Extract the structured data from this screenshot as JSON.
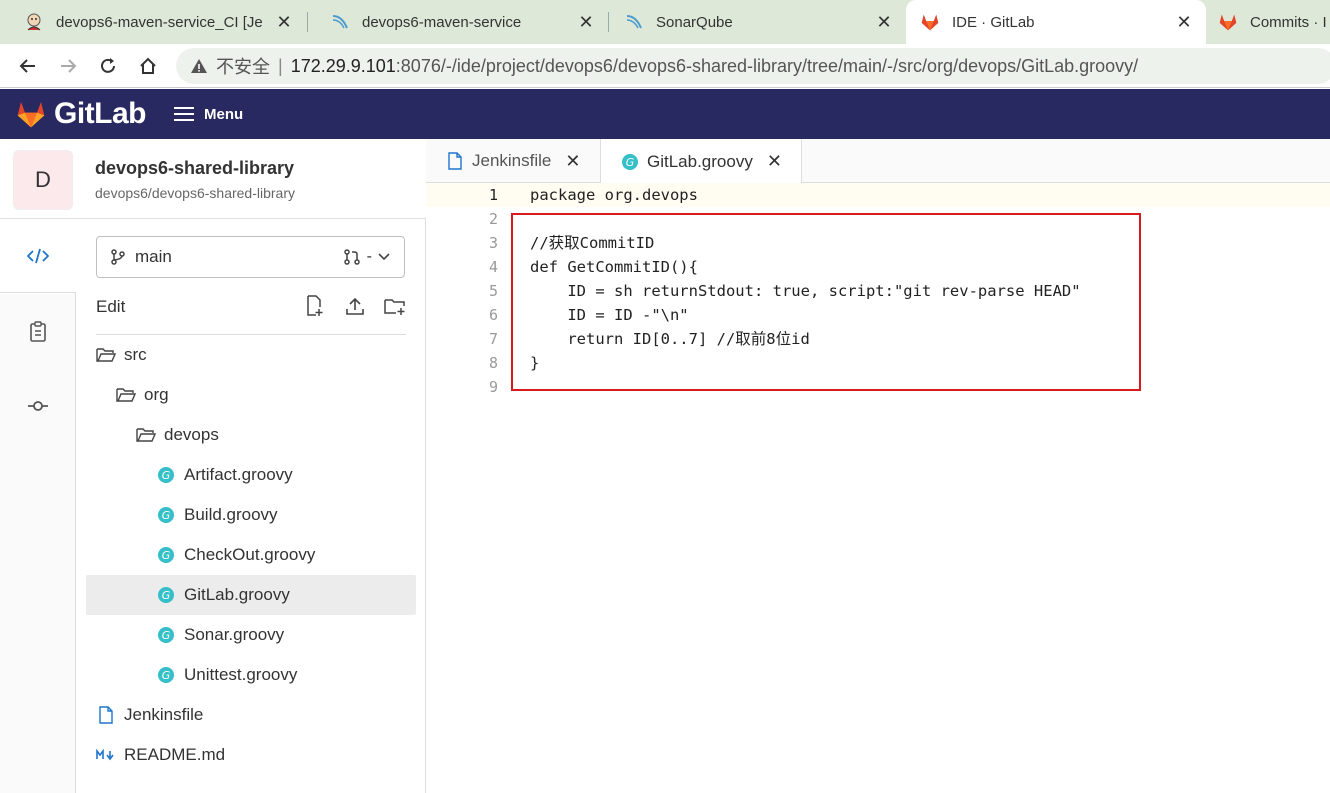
{
  "browser": {
    "tabs": [
      {
        "label": "devops6-maven-service_CI [Je",
        "icon": "jenkins-icon"
      },
      {
        "label": "devops6-maven-service",
        "icon": "sonarqube-icon"
      },
      {
        "label": "SonarQube",
        "icon": "sonarqube-icon"
      },
      {
        "label": "IDE · GitLab",
        "icon": "gitlab-icon",
        "active": true
      },
      {
        "label": "Commits · I",
        "icon": "gitlab-icon"
      }
    ],
    "address": {
      "insecure_label": "不安全",
      "separator": "|",
      "host": "172.29.9.101",
      "path": ":8076/-/ide/project/devops6/devops6-shared-library/tree/main/-/src/org/devops/GitLab.groovy/"
    }
  },
  "gitlab": {
    "brand": "GitLab",
    "menu_label": "Menu",
    "brand_color": "#292961"
  },
  "project": {
    "avatar_letter": "D",
    "name": "devops6-shared-library",
    "path": "devops6/devops6-shared-library"
  },
  "sidebar": {
    "branch": "main",
    "mr_label": "-",
    "edit_label": "Edit",
    "tree": [
      {
        "label": "src",
        "type": "folder",
        "depth": 0
      },
      {
        "label": "org",
        "type": "folder",
        "depth": 1
      },
      {
        "label": "devops",
        "type": "folder",
        "depth": 2
      },
      {
        "label": "Artifact.groovy",
        "type": "groovy",
        "depth": 3
      },
      {
        "label": "Build.groovy",
        "type": "groovy",
        "depth": 3
      },
      {
        "label": "CheckOut.groovy",
        "type": "groovy",
        "depth": 3
      },
      {
        "label": "GitLab.groovy",
        "type": "groovy",
        "depth": 3,
        "selected": true
      },
      {
        "label": "Sonar.groovy",
        "type": "groovy",
        "depth": 3
      },
      {
        "label": "Unittest.groovy",
        "type": "groovy",
        "depth": 3
      },
      {
        "label": "Jenkinsfile",
        "type": "file",
        "depth": 0
      },
      {
        "label": "README.md",
        "type": "markdown",
        "depth": 0
      }
    ]
  },
  "editor": {
    "tabs": [
      {
        "label": "Jenkinsfile",
        "icon": "file-icon"
      },
      {
        "label": "GitLab.groovy",
        "icon": "groovy-icon",
        "active": true
      }
    ],
    "lines": [
      {
        "n": "1",
        "text": "package org.devops"
      },
      {
        "n": "2",
        "text": ""
      },
      {
        "n": "3",
        "text": "//获取CommitID"
      },
      {
        "n": "4",
        "text": "def GetCommitID(){"
      },
      {
        "n": "5",
        "text": "    ID = sh returnStdout: true, script:\"git rev-parse HEAD\""
      },
      {
        "n": "6",
        "text": "    ID = ID -\"\\n\""
      },
      {
        "n": "7",
        "text": "    return ID[0..7] //取前8位id"
      },
      {
        "n": "8",
        "text": "}"
      },
      {
        "n": "9",
        "text": ""
      }
    ],
    "highlight_color": "#d71920"
  }
}
